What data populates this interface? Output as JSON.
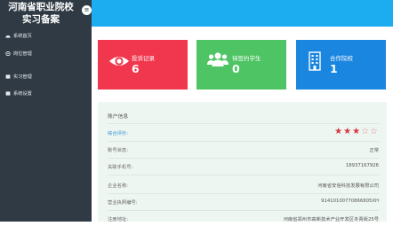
{
  "sidebar": {
    "brand_line1": "河南省职业院校",
    "brand_line2": "实习备案",
    "toggle_glyph": "≡",
    "items": [
      {
        "label": "系统首页",
        "icon": "dashboard-icon"
      },
      {
        "label": "岗位管理",
        "icon": "position-icon"
      },
      {
        "label": "实习管理",
        "icon": "internship-icon"
      },
      {
        "label": "系统设置",
        "icon": "settings-icon"
      }
    ]
  },
  "cards": [
    {
      "title": "投诉记录",
      "value": "6",
      "color": "#f0374d",
      "icon": "eye-icon"
    },
    {
      "title": "待签约学生",
      "value": "0",
      "color": "#4ec464",
      "icon": "users-icon"
    },
    {
      "title": "合作院校",
      "value": "1",
      "color": "#1b86e0",
      "icon": "building-icon"
    }
  ],
  "account": {
    "title": "账户信息",
    "rating_label": "综合评价:",
    "rating": 3,
    "rating_max": 5,
    "rows": [
      {
        "key": "账号状态:",
        "value": "正常"
      },
      {
        "key": "关联手机号:",
        "value": "18937167926"
      },
      {
        "key": "企业名称:",
        "value": "河南省安信科技发展有限公司"
      },
      {
        "key": "营业执照编号:",
        "value": "91410100770866805XH"
      },
      {
        "key": "注册地址:",
        "value": "河南省郑州市高新技术产业开发区冬青街25号"
      }
    ]
  },
  "colors": {
    "sidebar": "#2f3a44",
    "topbar": "#1cadf0",
    "panel": "#eef6f2",
    "star": "#d9333f"
  }
}
